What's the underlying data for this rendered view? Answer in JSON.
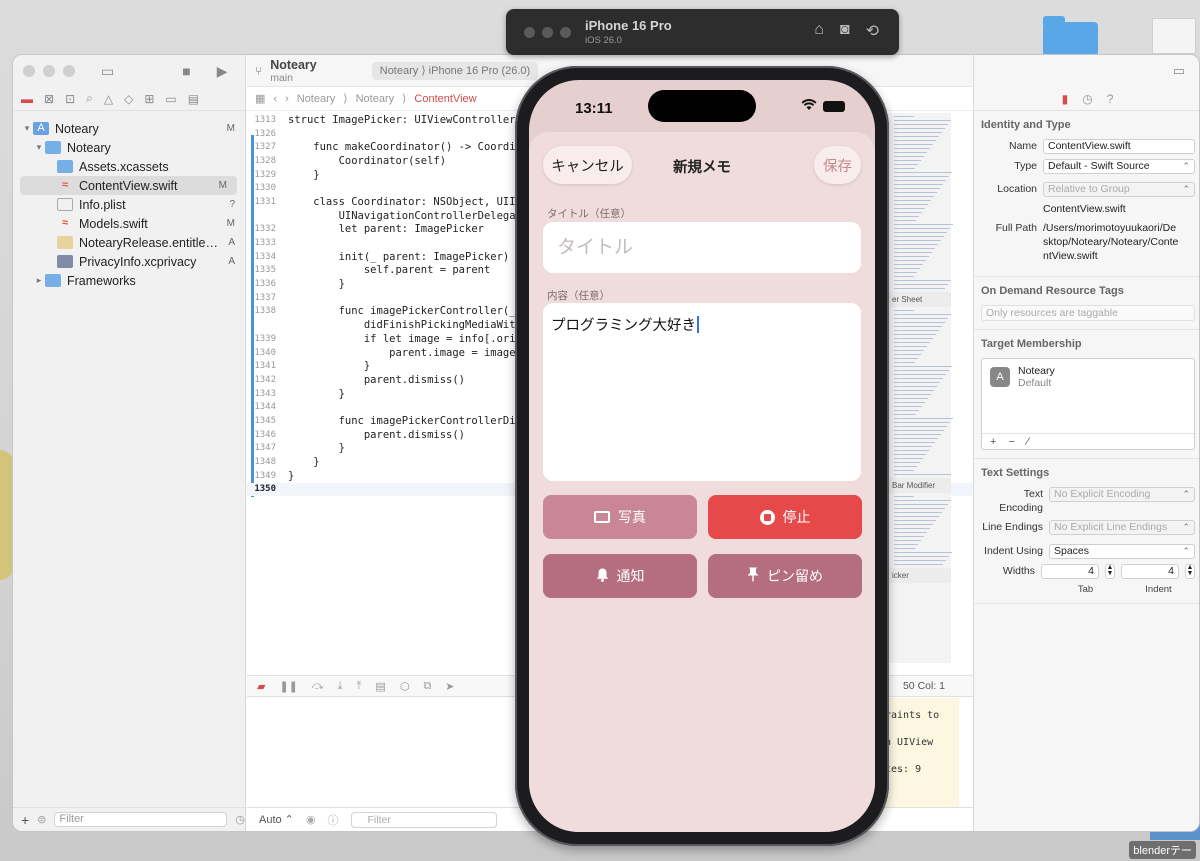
{
  "simulator": {
    "device": "iPhone 16 Pro",
    "os": "iOS 26.0"
  },
  "xcode": {
    "project_title": "Noteary",
    "branch": "main",
    "editor_tab": "Noteary ⟩ iPhone 16 Pro (26.0)",
    "jumpbar": [
      "Noteary",
      "Noteary",
      "ContentView"
    ],
    "navigator": [
      {
        "name": "Noteary",
        "badge": "M",
        "level": 0,
        "icon": "project-icon"
      },
      {
        "name": "Noteary",
        "badge": "",
        "level": 1,
        "icon": "folder-icon"
      },
      {
        "name": "Assets.xcassets",
        "badge": "",
        "level": 2,
        "icon": "assets-icon"
      },
      {
        "name": "ContentView.swift",
        "badge": "M",
        "level": 2,
        "icon": "swift-icon"
      },
      {
        "name": "Info.plist",
        "badge": "?",
        "level": 2,
        "icon": "plist-icon"
      },
      {
        "name": "Models.swift",
        "badge": "M",
        "level": 2,
        "icon": "swift-icon"
      },
      {
        "name": "NotearyRelease.entitlem...",
        "badge": "A",
        "level": 2,
        "icon": "entitlements-icon"
      },
      {
        "name": "PrivacyInfo.xcprivacy",
        "badge": "A",
        "level": 2,
        "icon": "privacy-icon"
      },
      {
        "name": "Frameworks",
        "badge": "",
        "level": 1,
        "icon": "folder-icon"
      }
    ],
    "navigator_filter": "Filter",
    "code": [
      {
        "ln": "1313",
        "text": "struct ImagePicker: UIViewControllerRep"
      },
      {
        "ln": "1326",
        "text": ""
      },
      {
        "ln": "1327",
        "text": "    func makeCoordinator() -> Coordinat"
      },
      {
        "ln": "1328",
        "text": "        Coordinator(self)"
      },
      {
        "ln": "1329",
        "text": "    }"
      },
      {
        "ln": "1330",
        "text": ""
      },
      {
        "ln": "1331",
        "text": "    class Coordinator: NSObject, UIIma"
      },
      {
        "ln": "",
        "text": "        UINavigationControllerDelegate"
      },
      {
        "ln": "1332",
        "text": "        let parent: ImagePicker"
      },
      {
        "ln": "1333",
        "text": ""
      },
      {
        "ln": "1334",
        "text": "        init(_ parent: ImagePicker) {"
      },
      {
        "ln": "1335",
        "text": "            self.parent = parent"
      },
      {
        "ln": "1336",
        "text": "        }"
      },
      {
        "ln": "1337",
        "text": ""
      },
      {
        "ln": "1338",
        "text": "        func imagePickerController(_ pi"
      },
      {
        "ln": "",
        "text": "            didFinishPickingMediaWithIn"
      },
      {
        "ln": "1339",
        "text": "            if let image = info[.origi"
      },
      {
        "ln": "1340",
        "text": "                parent.image = image"
      },
      {
        "ln": "1341",
        "text": "            }"
      },
      {
        "ln": "1342",
        "text": "            parent.dismiss()"
      },
      {
        "ln": "1343",
        "text": "        }"
      },
      {
        "ln": "1344",
        "text": ""
      },
      {
        "ln": "1345",
        "text": "        func imagePickerControllerDidCa"
      },
      {
        "ln": "1346",
        "text": "            parent.dismiss()"
      },
      {
        "ln": "1347",
        "text": "        }"
      },
      {
        "ln": "1348",
        "text": "    }"
      },
      {
        "ln": "1349",
        "text": "}"
      },
      {
        "ln": "1350",
        "text": ""
      }
    ],
    "minimap_labels": [
      "er Sheet",
      "Bar Modifier",
      "icker"
    ],
    "line_col": "50  Col: 1",
    "console_lines": [
      "raints to",
      "n UIView",
      "tes: 9"
    ],
    "bottom_mode": "Auto ⌃",
    "console_filter": "Filter"
  },
  "inspector": {
    "identity_header": "Identity and Type",
    "name_label": "Name",
    "name_value": "ContentView.swift",
    "type_label": "Type",
    "type_value": "Default - Swift Source",
    "location_label": "Location",
    "location_value": "Relative to Group",
    "location_file": "ContentView.swift",
    "fullpath_label": "Full Path",
    "fullpath_value": "/Users/morimotoyuukaori/Desktop/Noteary/Noteary/ContentView.swift",
    "odr_header": "On Demand Resource Tags",
    "odr_placeholder": "Only resources are taggable",
    "target_header": "Target Membership",
    "target_name": "Noteary",
    "target_sub": "Default",
    "text_header": "Text Settings",
    "encoding_label": "Text Encoding",
    "encoding_value": "No Explicit Encoding",
    "endings_label": "Line Endings",
    "endings_value": "No Explicit Line Endings",
    "indent_label": "Indent Using",
    "indent_value": "Spaces",
    "widths_label": "Widths",
    "tab_width": "4",
    "indent_width": "4",
    "tab_label": "Tab",
    "indent_sub_label": "Indent"
  },
  "app": {
    "time": "13:11",
    "cancel": "キャンセル",
    "title": "新規メモ",
    "save": "保存",
    "title_label": "タイトル（任意）",
    "title_placeholder": "タイトル",
    "content_label": "内容（任意）",
    "content_value": "プログラミング大好き",
    "buttons": {
      "photo": "写真",
      "stop": "停止",
      "notify": "通知",
      "pin": "ピン留め"
    },
    "colors": {
      "photo": "#c98694",
      "stop": "#e5494a",
      "notify": "#b56e80",
      "pin": "#b56e80",
      "background": "#f0dcdc"
    }
  },
  "desktop": {
    "label": "blenderテー"
  }
}
